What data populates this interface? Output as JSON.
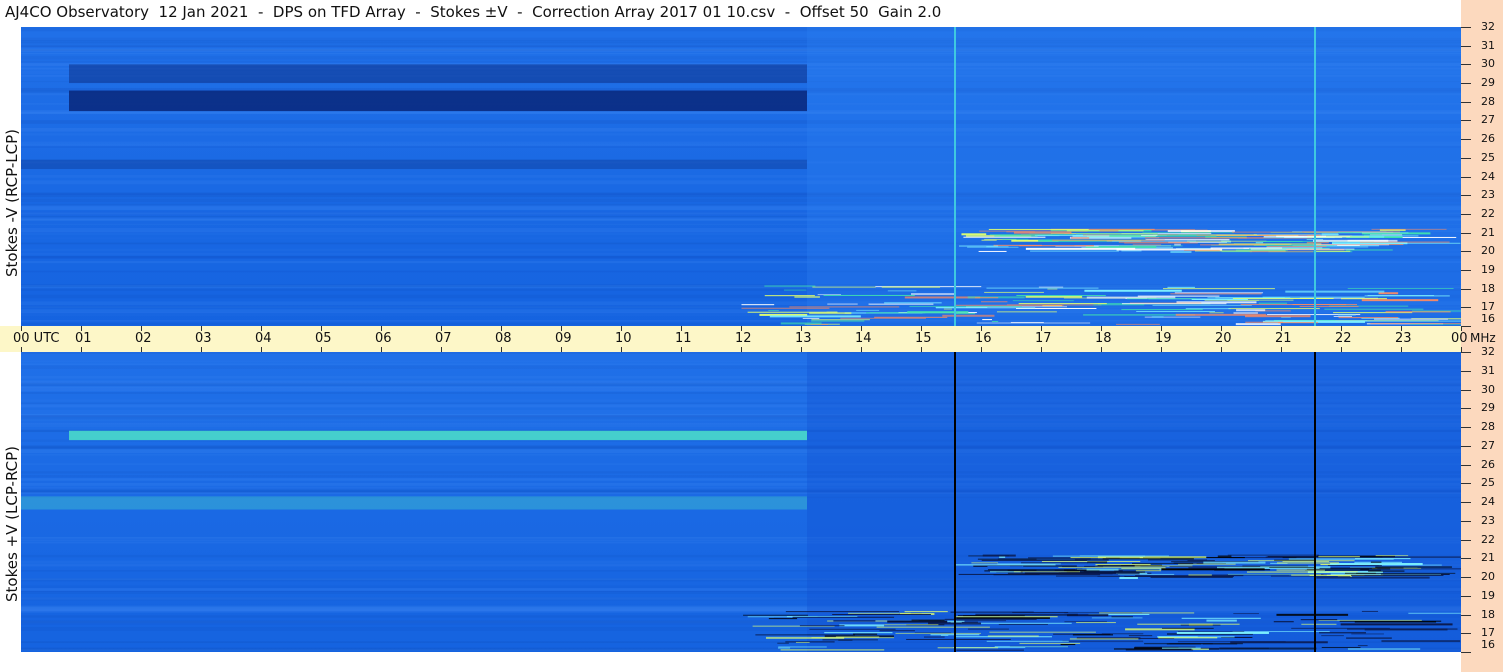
{
  "title": "AJ4CO Observatory  12 Jan 2021  -  DPS on TFD Array  -  Stokes ±V  -  Correction Array 2017 01 10.csv  -  Offset 50  Gain 2.0",
  "colors": {
    "background": "#1a6ae6",
    "axis_band": "#fdf7c8",
    "right_strip": "#fcd9be"
  },
  "chart_data": [
    {
      "type": "heatmap",
      "name": "Stokes -V (RCP-LCP)",
      "ylabel": "Stokes -V (RCP-LCP)",
      "y_ticks": [
        "32",
        "31",
        "30",
        "29",
        "28",
        "27",
        "26",
        "25",
        "24",
        "23",
        "22",
        "21",
        "20",
        "19",
        "18",
        "17",
        "16"
      ],
      "ylim": [
        16,
        32
      ],
      "xlim": [
        0,
        24
      ],
      "features": [
        {
          "kind": "dark_band",
          "x": [
            0.8,
            13.1
          ],
          "y": [
            27.5,
            28.6
          ],
          "intensity": 0.9
        },
        {
          "kind": "dark_band",
          "x": [
            0.8,
            13.1
          ],
          "y": [
            29.0,
            30.0
          ],
          "intensity": 0.5
        },
        {
          "kind": "dark_band",
          "x": [
            0,
            13.1
          ],
          "y": [
            24.4,
            24.9
          ],
          "intensity": 0.35
        },
        {
          "kind": "burst_lines",
          "x": [
            12.0,
            23.2
          ],
          "y": [
            16.1,
            18.2
          ]
        },
        {
          "kind": "burst_lines",
          "x": [
            15.5,
            22.7
          ],
          "y": [
            20.0,
            21.2
          ]
        },
        {
          "kind": "vertical_line",
          "x": 15.55
        },
        {
          "kind": "vertical_line",
          "x": 21.55
        }
      ]
    },
    {
      "type": "heatmap",
      "name": "Stokes +V (LCP-RCP)",
      "ylabel": "Stokes +V (LCP-RCP)",
      "y_ticks": [
        "32",
        "31",
        "30",
        "29",
        "28",
        "27",
        "26",
        "25",
        "24",
        "23",
        "22",
        "21",
        "20",
        "19",
        "18",
        "17",
        "16"
      ],
      "ylim": [
        16,
        32
      ],
      "xlim": [
        0,
        24
      ],
      "features": [
        {
          "kind": "bright_band",
          "x": [
            0.8,
            13.1
          ],
          "y": [
            27.3,
            27.8
          ],
          "intensity": 0.85
        },
        {
          "kind": "bright_band",
          "x": [
            0,
            13.1
          ],
          "y": [
            23.6,
            24.3
          ],
          "intensity": 0.35
        },
        {
          "kind": "burst_lines",
          "x": [
            12.0,
            23.2
          ],
          "y": [
            16.1,
            18.2
          ]
        },
        {
          "kind": "burst_lines",
          "x": [
            15.5,
            22.7
          ],
          "y": [
            20.0,
            21.2
          ]
        },
        {
          "kind": "vertical_line",
          "x": 15.55
        },
        {
          "kind": "vertical_line",
          "x": 21.55
        }
      ]
    }
  ],
  "time_axis": {
    "labels": [
      "00 UTC",
      "01",
      "02",
      "03",
      "04",
      "05",
      "06",
      "07",
      "08",
      "09",
      "10",
      "11",
      "12",
      "13",
      "14",
      "15",
      "16",
      "17",
      "18",
      "19",
      "20",
      "21",
      "22",
      "23",
      "00"
    ],
    "unit": "MHz"
  }
}
